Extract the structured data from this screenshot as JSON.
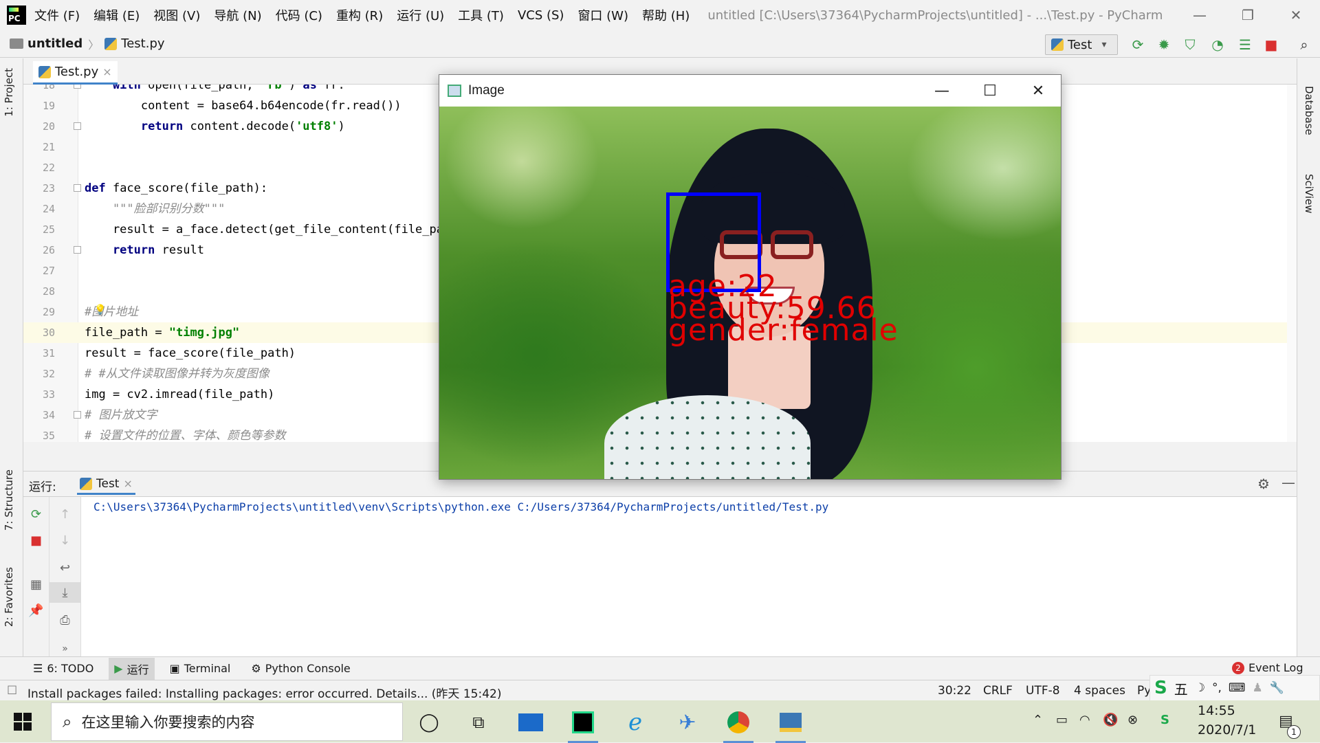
{
  "menubar": {
    "logo_text": "PC",
    "items": [
      "文件 (F)",
      "编辑 (E)",
      "视图 (V)",
      "导航 (N)",
      "代码 (C)",
      "重构 (R)",
      "运行 (U)",
      "工具 (T)",
      "VCS (S)",
      "窗口 (W)",
      "帮助 (H)"
    ],
    "window_title": "untitled [C:\\Users\\37364\\PycharmProjects\\untitled] - ...\\Test.py - PyCharm",
    "minimize": "—",
    "restore": "❐",
    "close": "✕"
  },
  "navbar": {
    "project": "untitled",
    "file": "Test.py",
    "run_config": "Test"
  },
  "left_strip": {
    "project_tab": "1: Project",
    "structure_tab": "7: Structure",
    "favorites_tab": "2: Favorites"
  },
  "right_strip": {
    "database_tab": "Database",
    "sciview_tab": "SciView"
  },
  "editor": {
    "tab_label": "Test.py",
    "tab_close": "×",
    "lines": [
      {
        "n": "18",
        "parts": [
          [
            "k",
            "    with "
          ],
          [
            "t",
            "open(file_path, "
          ],
          [
            "s",
            "'rb'"
          ],
          [
            "t",
            ") "
          ],
          [
            "k",
            "as"
          ],
          [
            "t",
            " fr:"
          ]
        ]
      },
      {
        "n": "19",
        "parts": [
          [
            "t",
            "        content = base64.b64encode(fr.read())"
          ]
        ]
      },
      {
        "n": "20",
        "parts": [
          [
            "k",
            "        return"
          ],
          [
            "t",
            " content.decode("
          ],
          [
            "s",
            "'utf8'"
          ],
          [
            "t",
            ")"
          ]
        ]
      },
      {
        "n": "21",
        "parts": []
      },
      {
        "n": "22",
        "parts": []
      },
      {
        "n": "23",
        "parts": [
          [
            "k",
            "def"
          ],
          [
            "t",
            " face_score(file_path):"
          ]
        ]
      },
      {
        "n": "24",
        "parts": [
          [
            "c",
            "    \"\"\"脸部识别分数\"\"\""
          ]
        ]
      },
      {
        "n": "25",
        "parts": [
          [
            "t",
            "    result = a_face.detect(get_file_content(file_pat"
          ]
        ]
      },
      {
        "n": "26",
        "parts": [
          [
            "k",
            "    return"
          ],
          [
            "t",
            " result"
          ]
        ]
      },
      {
        "n": "27",
        "parts": []
      },
      {
        "n": "28",
        "parts": []
      },
      {
        "n": "29",
        "parts": [
          [
            "c",
            "#图片地址"
          ]
        ]
      },
      {
        "n": "30",
        "parts": [
          [
            "t",
            "file_path = "
          ],
          [
            "s",
            "\"timg.jpg\""
          ]
        ]
      },
      {
        "n": "31",
        "parts": [
          [
            "t",
            "result = face_score(file_path)"
          ]
        ]
      },
      {
        "n": "32",
        "parts": [
          [
            "c",
            "# #从文件读取图像并转为灰度图像"
          ]
        ]
      },
      {
        "n": "33",
        "parts": [
          [
            "t",
            "img = cv2.imread(file_path)"
          ]
        ]
      },
      {
        "n": "34",
        "parts": [
          [
            "c",
            "# 图片放文字"
          ]
        ]
      },
      {
        "n": "35",
        "parts": [
          [
            "c",
            "# 设置文件的位置、字体、颜色等参数"
          ]
        ]
      }
    ]
  },
  "image_window": {
    "title": "Image",
    "minimize": "—",
    "maximize": "☐",
    "close": "✕",
    "annotations": {
      "age": "age:22",
      "beauty": "beauty:59.66",
      "gender": "gender:female"
    }
  },
  "run_panel": {
    "label": "运行:",
    "tab_label": "Test",
    "tab_close": "×",
    "command": "C:\\Users\\37364\\PycharmProjects\\untitled\\venv\\Scripts\\python.exe C:/Users/37364/PycharmProjects/untitled/Test.py"
  },
  "tool_tabs": {
    "todo": "6: TODO",
    "run": "运行",
    "terminal": "Terminal",
    "python_console": "Python Console",
    "event_log": "Event Log",
    "event_log_count": "2"
  },
  "statusbar": {
    "message": "Install packages failed: Installing packages: error occurred. Details... (昨天 15:42)",
    "position": "30:22",
    "line_sep": "CRLF",
    "encoding": "UTF-8",
    "indent": "4 spaces",
    "interpreter": "Py"
  },
  "taskbar": {
    "search_placeholder": "在这里输入你要搜索的内容",
    "time": "14:55",
    "date": "2020/7/1",
    "ime_label": "五",
    "notification_count": "1"
  },
  "colors": {
    "facebox": "#0000ff",
    "annotation": "#e00000",
    "keyword": "#000080",
    "string": "#008000",
    "comment": "#8c8c8c"
  }
}
